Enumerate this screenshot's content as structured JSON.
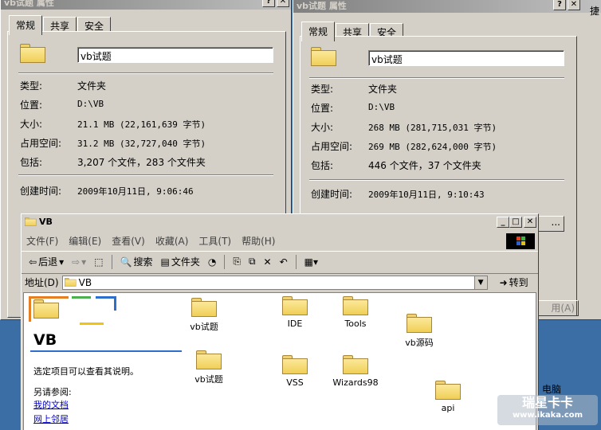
{
  "dialog1": {
    "title": "vb试题 属性",
    "tabs": [
      "常规",
      "共享",
      "安全"
    ],
    "name": "vb试题",
    "rows": [
      {
        "label": "类型:",
        "value": "文件夹"
      },
      {
        "label": "位置:",
        "value": "D:\\VB"
      },
      {
        "label": "大小:",
        "value": "21.1 MB (22,161,639 字节)"
      },
      {
        "label": "占用空间:",
        "value": "31.2 MB (32,727,040 字节)"
      },
      {
        "label": "包括:",
        "value": "3,207 个文件，283 个文件夹"
      }
    ],
    "created_label": "创建时间:",
    "created_value": "2009年10月11日, 9:06:46"
  },
  "dialog2": {
    "title": "vb试题 属性",
    "tabs": [
      "常规",
      "共享",
      "安全"
    ],
    "name": "vb试题",
    "rows": [
      {
        "label": "类型:",
        "value": "文件夹"
      },
      {
        "label": "位置:",
        "value": "D:\\VB"
      },
      {
        "label": "大小:",
        "value": "268 MB (281,715,031 字节)"
      },
      {
        "label": "占用空间:",
        "value": "269 MB (282,624,000 字节)"
      },
      {
        "label": "包括:",
        "value": "446 个文件，37 个文件夹"
      }
    ],
    "created_label": "创建时间:",
    "created_value": "2009年10月11日, 9:10:43",
    "partial_button": "...",
    "partial_button2": "用(A)",
    "partial_text": "捷"
  },
  "explorer": {
    "title": "VB",
    "menu": [
      "文件(F)",
      "编辑(E)",
      "查看(V)",
      "收藏(A)",
      "工具(T)",
      "帮助(H)"
    ],
    "toolbar": {
      "back": "后退",
      "search": "搜索",
      "folders": "文件夹"
    },
    "address_label": "地址(D)",
    "address_value": "VB",
    "go_label": "转到",
    "side_title": "VB",
    "side_hint": "选定项目可以查看其说明。",
    "see_also": "另请参阅:",
    "links": [
      "我的文档",
      "网上邻居"
    ],
    "items": [
      "vb试题",
      "IDE",
      "Tools",
      "vb源码",
      "vb试题",
      "VSS",
      "Wizards98",
      "api"
    ],
    "behind_text": "电脑"
  },
  "watermark": {
    "line1": "瑞星卡卡",
    "line2": "www.ikaka.com"
  }
}
